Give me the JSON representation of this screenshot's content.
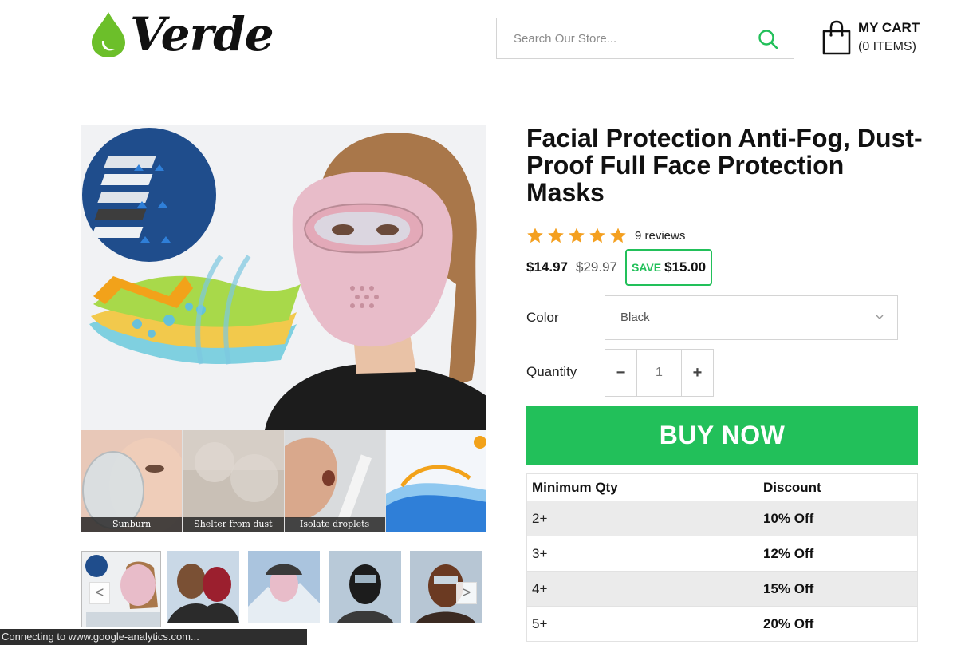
{
  "header": {
    "logo_text": "Verde",
    "search_placeholder": "Search Our Store...",
    "cart_title": "MY CART",
    "cart_count": "(0 ITEMS)"
  },
  "gallery": {
    "captions": [
      "Sunburn",
      "Shelter from dust",
      "Isolate droplets",
      ""
    ],
    "prev_label": "<",
    "next_label": ">"
  },
  "product": {
    "title": "Facial Protection Anti-Fog, Dust-Proof Full Face Protection Masks",
    "rating": 5,
    "reviews_text": "9 reviews",
    "price": "$14.97",
    "compare_price": "$29.97",
    "save_label": "SAVE",
    "save_amount": "$15.00",
    "color_label": "Color",
    "color_value": "Black",
    "quantity_label": "Quantity",
    "quantity_value": "1",
    "minus_label": "−",
    "plus_label": "+",
    "buy_label": "BUY NOW"
  },
  "discount_table": {
    "headers": [
      "Minimum Qty",
      "Discount"
    ],
    "rows": [
      [
        "2+",
        "10% Off"
      ],
      [
        "3+",
        "12% Off"
      ],
      [
        "4+",
        "15% Off"
      ],
      [
        "5+",
        "20% Off"
      ]
    ]
  },
  "status_bar": "Connecting to www.google-analytics.com...",
  "colors": {
    "accent": "#22c05a",
    "star": "#f4a020",
    "mask_pink": "#e8bcc9"
  }
}
